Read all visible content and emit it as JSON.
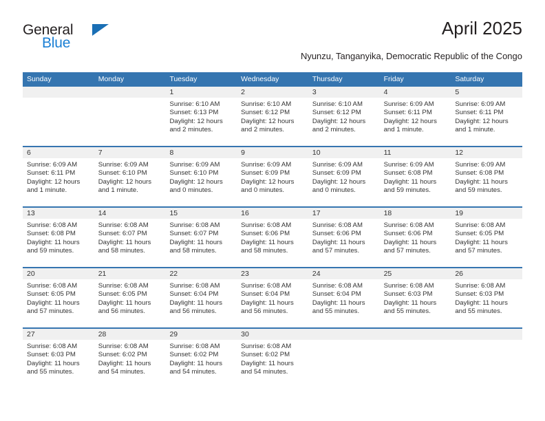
{
  "brand": {
    "name_top": "General",
    "name_bottom": "Blue",
    "flag_icon": "blue-triangle-flag-icon",
    "color_top": "#231f20",
    "color_bottom": "#1a7fd4",
    "flag_color": "#1a6fb5"
  },
  "header": {
    "title": "April 2025",
    "subtitle": "Nyunzu, Tanganyika, Democratic Republic of the Congo"
  },
  "theme": {
    "header_blue": "#3575b0",
    "daynum_band": "#f0f0f0",
    "text": "#333333"
  },
  "calendar": {
    "weekdays": [
      "Sunday",
      "Monday",
      "Tuesday",
      "Wednesday",
      "Thursday",
      "Friday",
      "Saturday"
    ],
    "weeks": [
      [
        {
          "day": "",
          "lines": []
        },
        {
          "day": "",
          "lines": []
        },
        {
          "day": "1",
          "lines": [
            "Sunrise: 6:10 AM",
            "Sunset: 6:13 PM",
            "Daylight: 12 hours",
            "and 2 minutes."
          ]
        },
        {
          "day": "2",
          "lines": [
            "Sunrise: 6:10 AM",
            "Sunset: 6:12 PM",
            "Daylight: 12 hours",
            "and 2 minutes."
          ]
        },
        {
          "day": "3",
          "lines": [
            "Sunrise: 6:10 AM",
            "Sunset: 6:12 PM",
            "Daylight: 12 hours",
            "and 2 minutes."
          ]
        },
        {
          "day": "4",
          "lines": [
            "Sunrise: 6:09 AM",
            "Sunset: 6:11 PM",
            "Daylight: 12 hours",
            "and 1 minute."
          ]
        },
        {
          "day": "5",
          "lines": [
            "Sunrise: 6:09 AM",
            "Sunset: 6:11 PM",
            "Daylight: 12 hours",
            "and 1 minute."
          ]
        }
      ],
      [
        {
          "day": "6",
          "lines": [
            "Sunrise: 6:09 AM",
            "Sunset: 6:11 PM",
            "Daylight: 12 hours",
            "and 1 minute."
          ]
        },
        {
          "day": "7",
          "lines": [
            "Sunrise: 6:09 AM",
            "Sunset: 6:10 PM",
            "Daylight: 12 hours",
            "and 1 minute."
          ]
        },
        {
          "day": "8",
          "lines": [
            "Sunrise: 6:09 AM",
            "Sunset: 6:10 PM",
            "Daylight: 12 hours",
            "and 0 minutes."
          ]
        },
        {
          "day": "9",
          "lines": [
            "Sunrise: 6:09 AM",
            "Sunset: 6:09 PM",
            "Daylight: 12 hours",
            "and 0 minutes."
          ]
        },
        {
          "day": "10",
          "lines": [
            "Sunrise: 6:09 AM",
            "Sunset: 6:09 PM",
            "Daylight: 12 hours",
            "and 0 minutes."
          ]
        },
        {
          "day": "11",
          "lines": [
            "Sunrise: 6:09 AM",
            "Sunset: 6:08 PM",
            "Daylight: 11 hours",
            "and 59 minutes."
          ]
        },
        {
          "day": "12",
          "lines": [
            "Sunrise: 6:09 AM",
            "Sunset: 6:08 PM",
            "Daylight: 11 hours",
            "and 59 minutes."
          ]
        }
      ],
      [
        {
          "day": "13",
          "lines": [
            "Sunrise: 6:08 AM",
            "Sunset: 6:08 PM",
            "Daylight: 11 hours",
            "and 59 minutes."
          ]
        },
        {
          "day": "14",
          "lines": [
            "Sunrise: 6:08 AM",
            "Sunset: 6:07 PM",
            "Daylight: 11 hours",
            "and 58 minutes."
          ]
        },
        {
          "day": "15",
          "lines": [
            "Sunrise: 6:08 AM",
            "Sunset: 6:07 PM",
            "Daylight: 11 hours",
            "and 58 minutes."
          ]
        },
        {
          "day": "16",
          "lines": [
            "Sunrise: 6:08 AM",
            "Sunset: 6:06 PM",
            "Daylight: 11 hours",
            "and 58 minutes."
          ]
        },
        {
          "day": "17",
          "lines": [
            "Sunrise: 6:08 AM",
            "Sunset: 6:06 PM",
            "Daylight: 11 hours",
            "and 57 minutes."
          ]
        },
        {
          "day": "18",
          "lines": [
            "Sunrise: 6:08 AM",
            "Sunset: 6:06 PM",
            "Daylight: 11 hours",
            "and 57 minutes."
          ]
        },
        {
          "day": "19",
          "lines": [
            "Sunrise: 6:08 AM",
            "Sunset: 6:05 PM",
            "Daylight: 11 hours",
            "and 57 minutes."
          ]
        }
      ],
      [
        {
          "day": "20",
          "lines": [
            "Sunrise: 6:08 AM",
            "Sunset: 6:05 PM",
            "Daylight: 11 hours",
            "and 57 minutes."
          ]
        },
        {
          "day": "21",
          "lines": [
            "Sunrise: 6:08 AM",
            "Sunset: 6:05 PM",
            "Daylight: 11 hours",
            "and 56 minutes."
          ]
        },
        {
          "day": "22",
          "lines": [
            "Sunrise: 6:08 AM",
            "Sunset: 6:04 PM",
            "Daylight: 11 hours",
            "and 56 minutes."
          ]
        },
        {
          "day": "23",
          "lines": [
            "Sunrise: 6:08 AM",
            "Sunset: 6:04 PM",
            "Daylight: 11 hours",
            "and 56 minutes."
          ]
        },
        {
          "day": "24",
          "lines": [
            "Sunrise: 6:08 AM",
            "Sunset: 6:04 PM",
            "Daylight: 11 hours",
            "and 55 minutes."
          ]
        },
        {
          "day": "25",
          "lines": [
            "Sunrise: 6:08 AM",
            "Sunset: 6:03 PM",
            "Daylight: 11 hours",
            "and 55 minutes."
          ]
        },
        {
          "day": "26",
          "lines": [
            "Sunrise: 6:08 AM",
            "Sunset: 6:03 PM",
            "Daylight: 11 hours",
            "and 55 minutes."
          ]
        }
      ],
      [
        {
          "day": "27",
          "lines": [
            "Sunrise: 6:08 AM",
            "Sunset: 6:03 PM",
            "Daylight: 11 hours",
            "and 55 minutes."
          ]
        },
        {
          "day": "28",
          "lines": [
            "Sunrise: 6:08 AM",
            "Sunset: 6:02 PM",
            "Daylight: 11 hours",
            "and 54 minutes."
          ]
        },
        {
          "day": "29",
          "lines": [
            "Sunrise: 6:08 AM",
            "Sunset: 6:02 PM",
            "Daylight: 11 hours",
            "and 54 minutes."
          ]
        },
        {
          "day": "30",
          "lines": [
            "Sunrise: 6:08 AM",
            "Sunset: 6:02 PM",
            "Daylight: 11 hours",
            "and 54 minutes."
          ]
        },
        {
          "day": "",
          "lines": []
        },
        {
          "day": "",
          "lines": []
        },
        {
          "day": "",
          "lines": []
        }
      ]
    ]
  }
}
